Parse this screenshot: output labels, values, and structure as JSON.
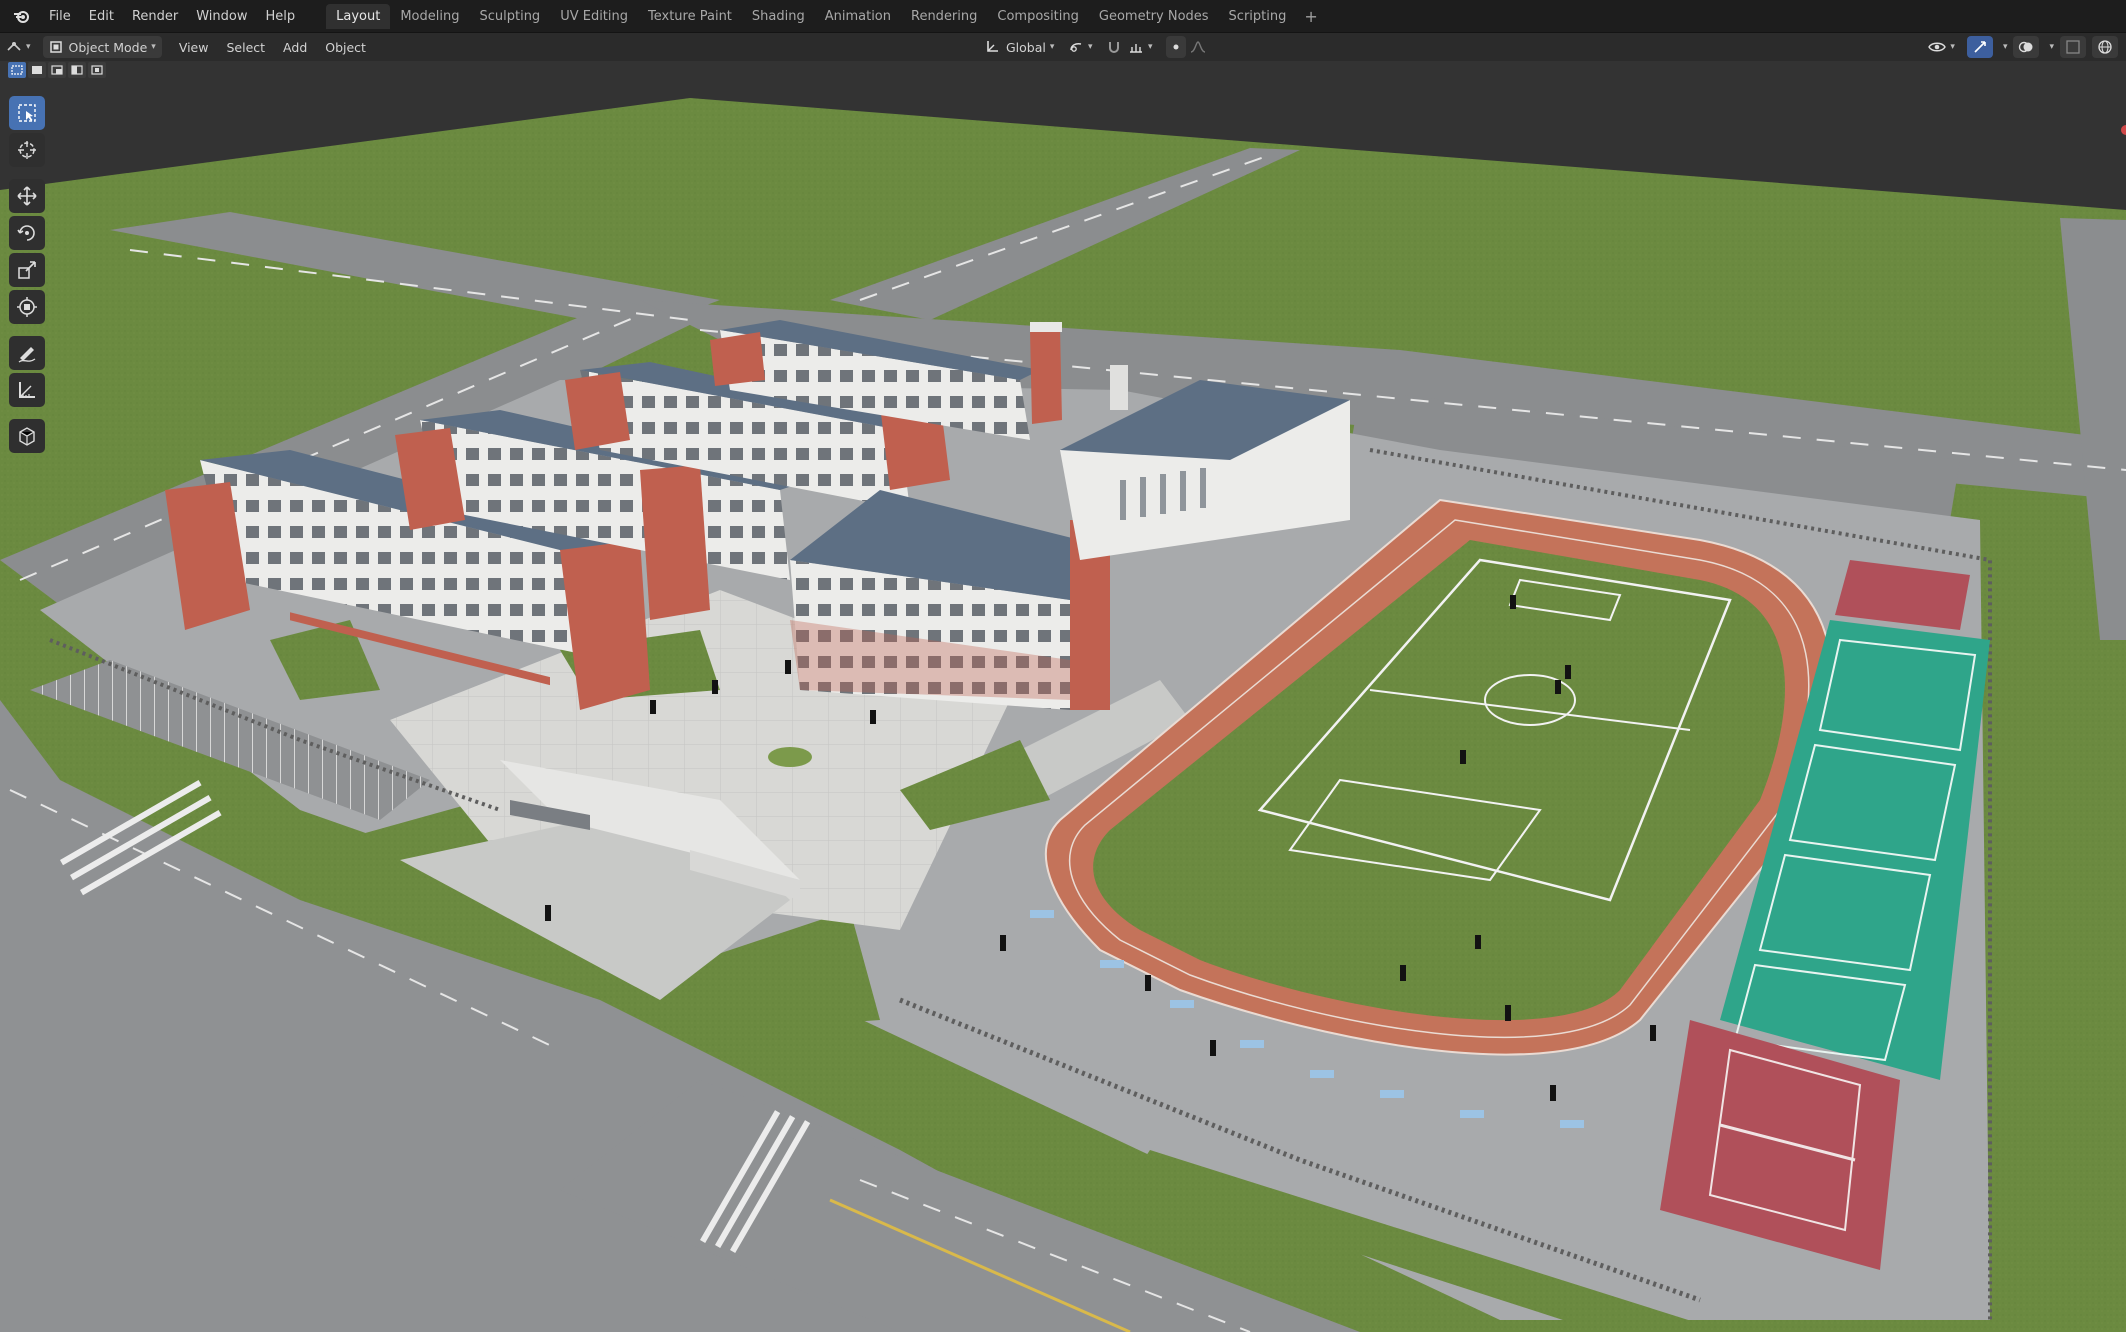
{
  "menu": {
    "items": [
      "File",
      "Edit",
      "Render",
      "Window",
      "Help"
    ]
  },
  "workspaces": {
    "tabs": [
      "Layout",
      "Modeling",
      "Sculpting",
      "UV Editing",
      "Texture Paint",
      "Shading",
      "Animation",
      "Rendering",
      "Compositing",
      "Geometry Nodes",
      "Scripting"
    ],
    "active": "Layout",
    "add_label": "+"
  },
  "header": {
    "mode": "Object Mode",
    "menus": [
      "View",
      "Select",
      "Add",
      "Object"
    ],
    "orientation": "Global"
  },
  "toolbar": {
    "tools": [
      "select-box",
      "cursor",
      "move",
      "rotate",
      "scale",
      "transform",
      "annotate",
      "measure",
      "add-cube"
    ],
    "active": "select-box"
  },
  "colors": {
    "accent": "#4772b3",
    "grass": "#6b8a40",
    "track": "#c4735a",
    "court": "#2fa58a",
    "brick": "#c0604f",
    "roof": "#5d6f84"
  }
}
